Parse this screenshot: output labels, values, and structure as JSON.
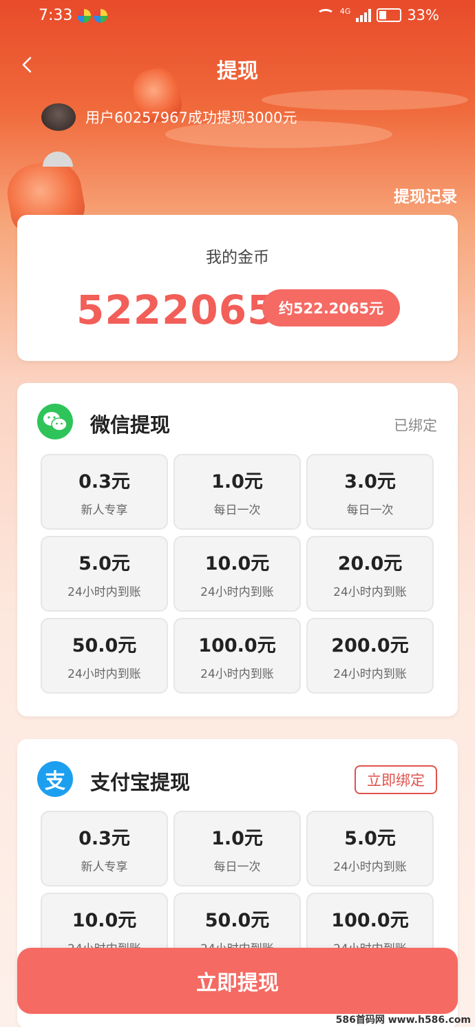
{
  "status_bar": {
    "time": "7:33",
    "network": "4G",
    "battery": "33%"
  },
  "header": {
    "title": "提现",
    "ticker_text": "用户60257967成功提现3000元",
    "records_link": "提现记录"
  },
  "coins": {
    "label": "我的金币",
    "amount": "5222065",
    "cny_label": "约522.2065元"
  },
  "wechat": {
    "title": "微信提现",
    "status": "已绑定",
    "options": [
      {
        "amount": "0.3元",
        "note": "新人专享"
      },
      {
        "amount": "1.0元",
        "note": "每日一次"
      },
      {
        "amount": "3.0元",
        "note": "每日一次"
      },
      {
        "amount": "5.0元",
        "note": "24小时内到账"
      },
      {
        "amount": "10.0元",
        "note": "24小时内到账"
      },
      {
        "amount": "20.0元",
        "note": "24小时内到账"
      },
      {
        "amount": "50.0元",
        "note": "24小时内到账"
      },
      {
        "amount": "100.0元",
        "note": "24小时内到账"
      },
      {
        "amount": "200.0元",
        "note": "24小时内到账"
      }
    ]
  },
  "alipay": {
    "title": "支付宝提现",
    "icon_char": "支",
    "bind_label": "立即绑定",
    "options": [
      {
        "amount": "0.3元",
        "note": "新人专享"
      },
      {
        "amount": "1.0元",
        "note": "每日一次"
      },
      {
        "amount": "5.0元",
        "note": "24小时内到账"
      },
      {
        "amount": "10.0元",
        "note": "24小时内到账"
      },
      {
        "amount": "50.0元",
        "note": "24小时内到账"
      },
      {
        "amount": "100.0元",
        "note": "24小时内到账"
      }
    ]
  },
  "footer": {
    "withdraw_button": "立即提现",
    "watermark": "586首码网 www.h586.com"
  }
}
